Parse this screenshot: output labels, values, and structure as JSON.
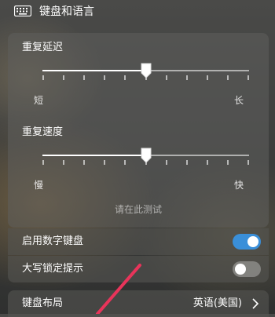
{
  "header": {
    "title": "键盘和语言",
    "icon": "keyboard-icon"
  },
  "repeat_delay": {
    "label": "重复延迟",
    "min_label": "短",
    "max_label": "长",
    "ticks": 11,
    "value_fraction": 0.5
  },
  "repeat_rate": {
    "label": "重复速度",
    "min_label": "慢",
    "max_label": "快",
    "ticks": 11,
    "value_fraction": 0.5
  },
  "test_field": {
    "placeholder": "请在此测试"
  },
  "numeric_keypad": {
    "label": "启用数字键盘",
    "enabled": true
  },
  "caps_lock_hint": {
    "label": "大写锁定提示",
    "enabled": false
  },
  "keyboard_layout": {
    "label": "键盘布局",
    "value": "英语(美国)"
  },
  "colors": {
    "toggle_on": "#3a8fd9",
    "annotation_arrow": "#e8345a"
  }
}
